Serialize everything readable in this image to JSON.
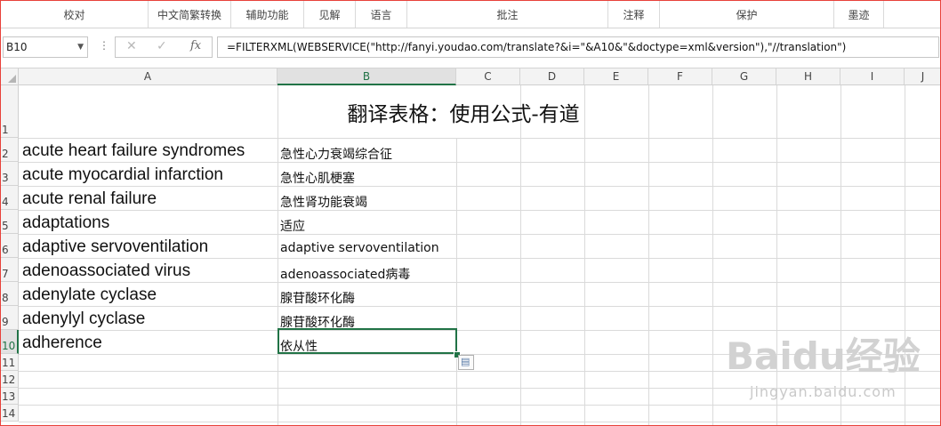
{
  "ribbon": {
    "groups": [
      "校对",
      "中文简繁转换",
      "辅助功能",
      "见解",
      "语言",
      "批注",
      "注释",
      "保护",
      "墨迹"
    ]
  },
  "formula_bar": {
    "name_box": "B10",
    "fx": "fx",
    "formula": "=FILTERXML(WEBSERVICE(\"http://fanyi.youdao.com/translate?&i=\"&A10&\"&doctype=xml&version\"),\"//translation\")"
  },
  "columns": [
    "A",
    "B",
    "C",
    "D",
    "E",
    "F",
    "G",
    "H",
    "I",
    "J"
  ],
  "rows": [
    "1",
    "2",
    "3",
    "4",
    "5",
    "6",
    "7",
    "8",
    "9",
    "10",
    "11",
    "12",
    "13",
    "14"
  ],
  "sheet": {
    "title": "翻译表格：使用公式-有道",
    "data": [
      {
        "en": "acute heart failure syndromes",
        "zh": "急性心力衰竭综合征"
      },
      {
        "en": "acute myocardial infarction",
        "zh": "急性心肌梗塞"
      },
      {
        "en": "acute renal failure",
        "zh": "急性肾功能衰竭"
      },
      {
        "en": "adaptations",
        "zh": "适应"
      },
      {
        "en": "adaptive servoventilation",
        "zh": "adaptive servoventilation"
      },
      {
        "en": "adenoassociated virus",
        "zh": "adenoassociated病毒"
      },
      {
        "en": "adenylate cyclase",
        "zh": "腺苷酸环化酶"
      },
      {
        "en": "adenylyl cyclase",
        "zh": "腺苷酸环化酶"
      },
      {
        "en": "adherence",
        "zh": "依从性"
      }
    ]
  },
  "watermark": {
    "logo": "Baidu经验",
    "url": "jingyan.baidu.com"
  },
  "accent_color": "#217346"
}
